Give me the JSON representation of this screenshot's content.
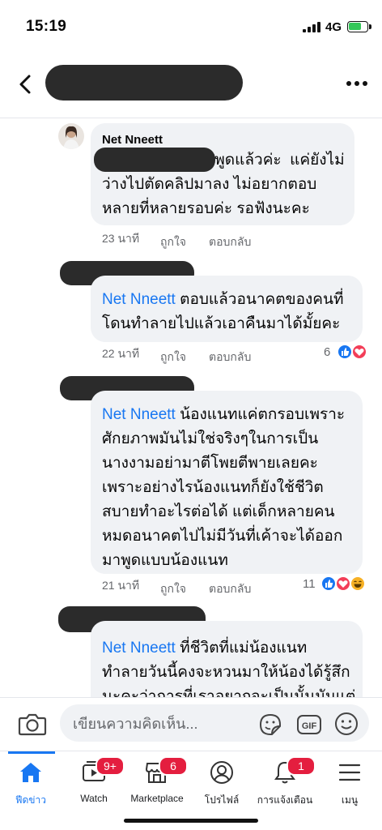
{
  "status_bar": {
    "time": "15:19",
    "network": "4G"
  },
  "comments": [
    {
      "author": "Net Nneett",
      "line1_suffix": " พูดแล้วค่ะ  แค่ยังไม่",
      "lines": [
        "ว่างไปตัดคลิปมาลง ไม่อยากตอบ",
        "หลายที่หลายรอบค่ะ รอฟังนะคะ"
      ],
      "time": "23 นาที",
      "like": "ถูกใจ",
      "reply": "ตอบกลับ"
    },
    {
      "mention": "Net Nneett",
      "line1_suffix": " ตอบแล้วอนาคตของคนที่",
      "lines": [
        "โดนทำลายไปแล้วเอาคืนมาได้มั้ยคะ"
      ],
      "time": "22 นาที",
      "like": "ถูกใจ",
      "reply": "ตอบกลับ",
      "reaction_count": "6"
    },
    {
      "mention": "Net Nneett",
      "line1_suffix": " น้องแนทแค่ตกรอบเพราะ",
      "lines": [
        "ศักยภาพมันไม่ใช่จริงๆในการเป็น",
        "นางงามอย่ามาตีโพยตีพายเลยคะ",
        "เพราะอย่างไรน้องแนทก็ยังใช้ชีวิต",
        "สบายทำอะไรต่อได้ แต่เด็กหลายคน",
        "หมดอนาคตไปไม่มีวันที่เค้าจะได้ออก",
        "มาพูดแบบน้องแนท"
      ],
      "time": "21 นาที",
      "like": "ถูกใจ",
      "reply": "ตอบกลับ",
      "reaction_count": "11"
    },
    {
      "mention": "Net Nneett",
      "line1_suffix": " ที่ชีวิตที่แม่น้องแนท",
      "lines": [
        "ทำลายวันนี้คงจะหวนมาให้น้องได้รู้สึก",
        "นะคะว่าการที่เราอยากจะเป็นนั้นมันแต่"
      ]
    }
  ],
  "composer": {
    "placeholder": "เขียนความคิดเห็น..."
  },
  "tabs": [
    {
      "label": "ฟีดข่าว"
    },
    {
      "label": "Watch",
      "badge": "9+"
    },
    {
      "label": "Marketplace",
      "badge": "6"
    },
    {
      "label": "โปรไฟล์"
    },
    {
      "label": "การแจ้งเตือน",
      "badge": "1"
    },
    {
      "label": "เมนู"
    }
  ],
  "colors": {
    "accent": "#1877f2",
    "bubble": "#f0f2f5",
    "badge": "#e41e3f",
    "meta": "#65676b"
  }
}
